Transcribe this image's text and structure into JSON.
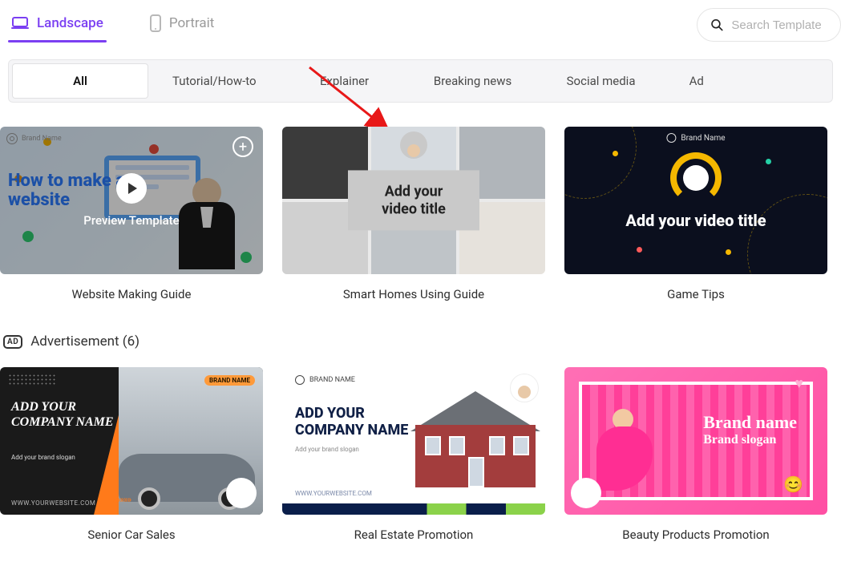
{
  "orientation": {
    "landscape": "Landscape",
    "portrait": "Portrait"
  },
  "search": {
    "placeholder": "Search Template"
  },
  "categories": {
    "all": "All",
    "tutorial": "Tutorial/How-to",
    "explainer": "Explainer",
    "breaking": "Breaking news",
    "social": "Social media",
    "ad": "Ad"
  },
  "row1": {
    "hover": {
      "preview_label": "Preview Template",
      "brand_label": "Brand Name"
    },
    "card1": {
      "title": "Website Making Guide",
      "thumb_text": "How to make a website"
    },
    "card2": {
      "title": "Smart Homes Using Guide",
      "thumb_text": "Add your video title"
    },
    "card3": {
      "title": "Game Tips",
      "thumb_text": "Add your video title",
      "brand_label": "Brand Name"
    }
  },
  "section_ad": {
    "badge": "AD",
    "label": "Advertisement (6)"
  },
  "row2": {
    "card1": {
      "title": "Senior Car Sales",
      "thumb_head": "ADD YOUR COMPANY NAME",
      "thumb_slogan": "Add your brand slogan",
      "thumb_site": "WWW.YOURWEBSITE.COM",
      "brand_badge": "BRAND NAME"
    },
    "card2": {
      "title": "Real Estate Promotion",
      "thumb_head": "ADD YOUR COMPANY NAME",
      "thumb_slogan": "Add your brand slogan",
      "thumb_site": "WWW.YOURWEBSITE.COM",
      "brand_label": "BRAND NAME"
    },
    "card3": {
      "title": "Beauty Products Promotion",
      "brand_name": "Brand name",
      "brand_slogan": "Brand slogan"
    }
  }
}
